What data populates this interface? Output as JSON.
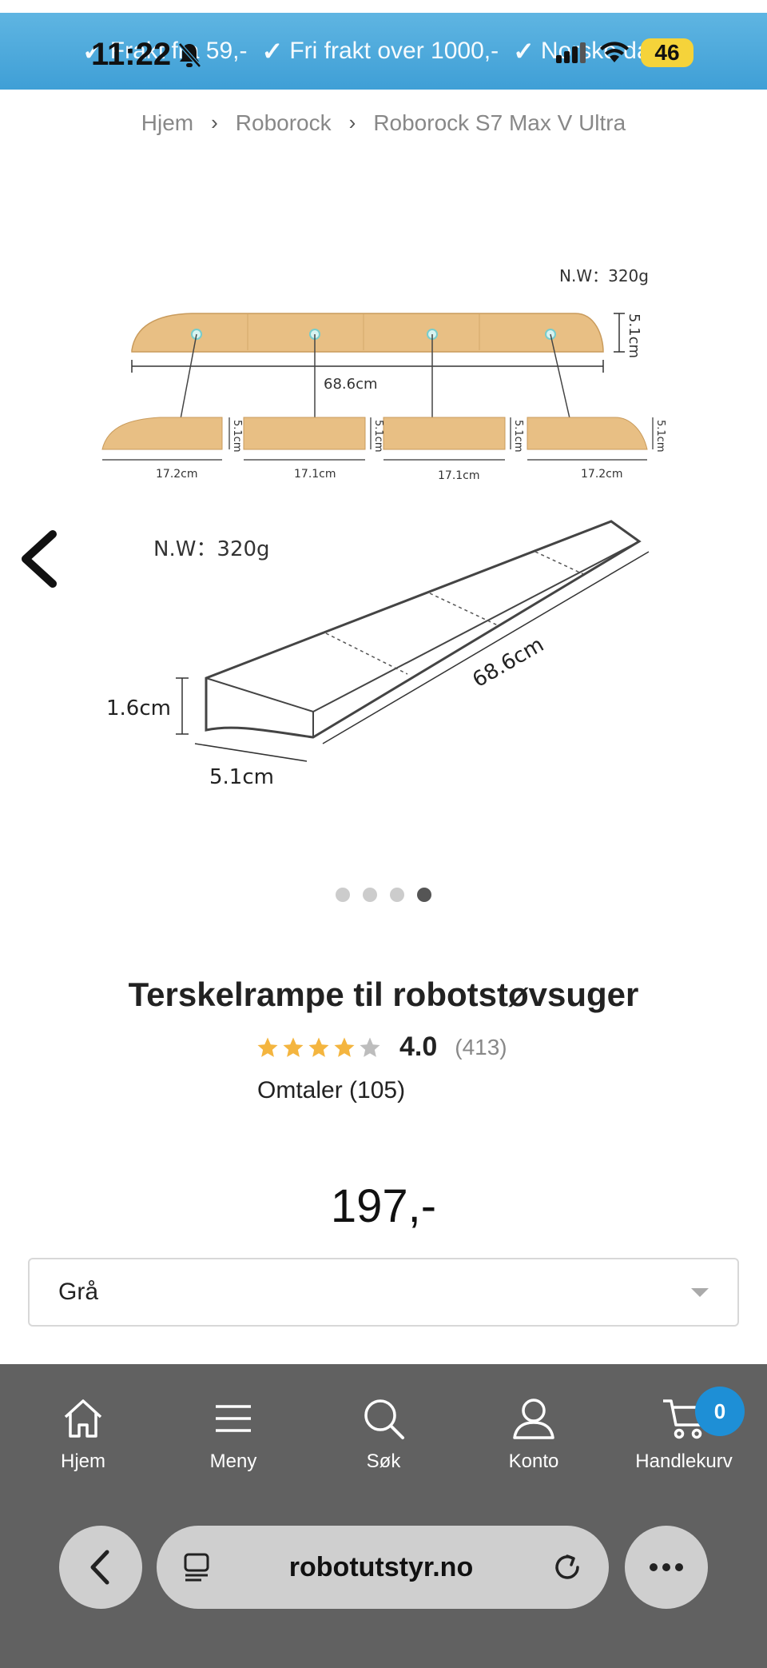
{
  "status_bar": {
    "time": "11:22",
    "battery": "46"
  },
  "promo": {
    "items": [
      "Frakt fra 59,-",
      "Fri frakt over 1000,-",
      "Norske dager"
    ]
  },
  "breadcrumb": [
    "Hjem",
    "Roborock",
    "Roborock S7 Max V Ultra"
  ],
  "gallery": {
    "top_image": {
      "weight": "N.W：320g",
      "total_length": "68.6cm",
      "height": "5.1cm",
      "segments": [
        "17.2cm",
        "17.1cm",
        "17.1cm",
        "17.2cm"
      ],
      "segment_height": "5.1cm"
    },
    "bottom_image": {
      "weight": "N.W：320g",
      "height": "1.6cm",
      "width": "5.1cm",
      "length": "68.6cm"
    },
    "dots_total": 4,
    "active_dot": 4
  },
  "product": {
    "title": "Terskelrampe til robotstøvsuger",
    "rating": 4.0,
    "rating_label": "4.0",
    "rating_count": "(413)",
    "reviews_label": "Omtaler (105)",
    "price": "197,-",
    "variant": "Grå"
  },
  "bottom_nav": {
    "items": [
      {
        "label": "Hjem",
        "icon": "home-icon"
      },
      {
        "label": "Meny",
        "icon": "menu-icon"
      },
      {
        "label": "Søk",
        "icon": "search-icon"
      },
      {
        "label": "Konto",
        "icon": "account-icon"
      },
      {
        "label": "Handlekurv",
        "icon": "cart-icon"
      }
    ],
    "cart_count": "0"
  },
  "browser": {
    "url": "robotutstyr.no"
  },
  "colors": {
    "promo_bar": "#4aa9dd",
    "star": "#f4b53f",
    "nav_bg": "#616161",
    "cart_badge": "#1e8fd6",
    "wood": "#e8bf84"
  }
}
